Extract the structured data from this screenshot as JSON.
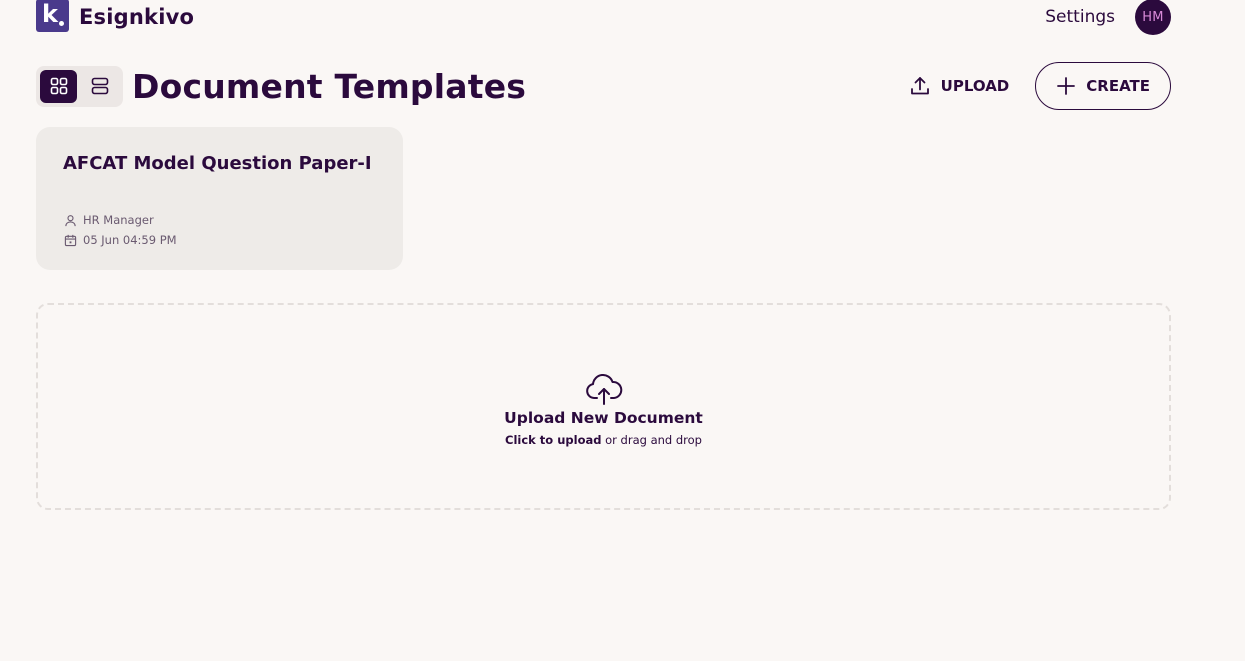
{
  "brand": {
    "name": "Esignkivo",
    "logo_letter": "k"
  },
  "topnav": {
    "settings_label": "Settings",
    "avatar_initials": "HM"
  },
  "page": {
    "title": "Document Templates"
  },
  "actions": {
    "upload_label": "UPLOAD",
    "create_label": "CREATE"
  },
  "view_toggle": {
    "active": "grid",
    "options": [
      "grid",
      "list"
    ]
  },
  "templates": [
    {
      "title": "AFCAT Model Question Paper-I",
      "owner": "HR Manager",
      "date": "05 Jun 04:59 PM"
    }
  ],
  "dropzone": {
    "title": "Upload New Document",
    "click_text": "Click to upload",
    "rest_text": " or drag and drop"
  },
  "colors": {
    "primary": "#2b0a3d",
    "background": "#faf7f5",
    "card": "#eeebe8",
    "logo": "#4a3a8c"
  }
}
